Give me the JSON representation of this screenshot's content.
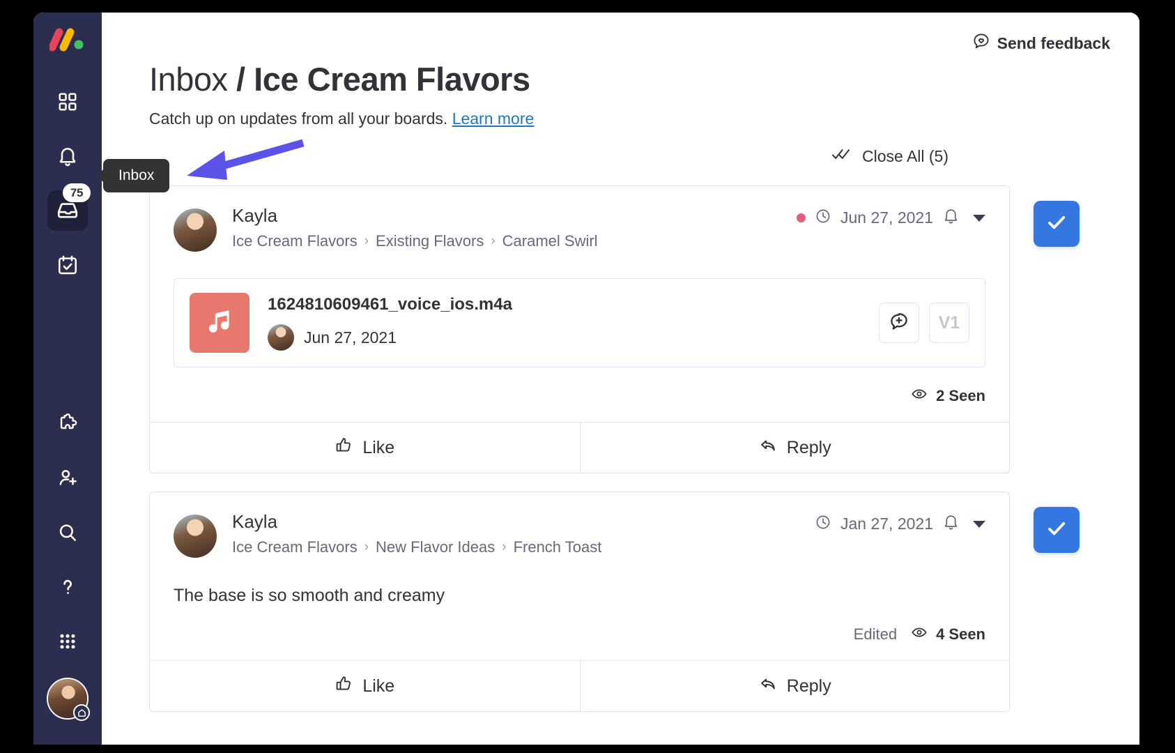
{
  "sidebar": {
    "logo_name": "monday-logo",
    "items": [
      {
        "name": "home-grid",
        "icon": "grid-icon",
        "label": "Home"
      },
      {
        "name": "notifications",
        "icon": "bell-icon",
        "label": "Notifications"
      },
      {
        "name": "inbox",
        "icon": "inbox-icon",
        "label": "Inbox",
        "badge": "75",
        "active": true
      },
      {
        "name": "my-work",
        "icon": "calendar-check-icon",
        "label": "My Work"
      },
      {
        "name": "apps",
        "icon": "puzzle-icon",
        "label": "Apps"
      },
      {
        "name": "invite",
        "icon": "person-add-icon",
        "label": "Invite members"
      },
      {
        "name": "search",
        "icon": "search-icon",
        "label": "Search"
      },
      {
        "name": "help",
        "icon": "question-mark-icon",
        "label": "Help"
      },
      {
        "name": "more",
        "icon": "dots-grid-icon",
        "label": "More"
      }
    ],
    "avatar_label": "Kayla",
    "tooltip": "Inbox"
  },
  "header": {
    "feedback_label": "Send feedback",
    "feedback_icon": "speech-bubble-heart-icon",
    "title_prefix": "Inbox ",
    "title_separator": "/ ",
    "title_main": "Ice Cream Flavors",
    "subtitle": "Catch up on updates from all your boards.",
    "learn_more": "Learn more",
    "close_all": "Close All (5)",
    "close_all_icon": "double-check-icon"
  },
  "feed": {
    "items": [
      {
        "user": "Kayla",
        "breadcrumb": [
          "Ice Cream Flavors",
          "Existing Flavors",
          "Caramel Swirl"
        ],
        "unread": true,
        "date": "Jun 27, 2021",
        "clock_icon": "clock-icon",
        "bell_icon": "bell-icon",
        "caret_icon": "chevron-down-icon",
        "attachment": {
          "file_name": "1624810609461_voice_ios.m4a",
          "file_date": "Jun 27, 2021",
          "file_icon": "music-note-icon",
          "comment_button_icon": "add-comment-icon",
          "version_label": "V1"
        },
        "edited": "",
        "seen": "2 Seen",
        "seen_icon": "eye-icon",
        "like_label": "Like",
        "like_icon": "thumbs-up-icon",
        "reply_label": "Reply",
        "reply_icon": "reply-arrow-icon",
        "close_icon": "check-icon"
      },
      {
        "user": "Kayla",
        "breadcrumb": [
          "Ice Cream Flavors",
          "New Flavor Ideas",
          "French Toast"
        ],
        "unread": false,
        "date": "Jan 27, 2021",
        "clock_icon": "clock-icon",
        "bell_icon": "bell-icon",
        "caret_icon": "chevron-down-icon",
        "message": "The base is so smooth and creamy",
        "edited": "Edited",
        "seen": "4 Seen",
        "seen_icon": "eye-icon",
        "like_label": "Like",
        "like_icon": "thumbs-up-icon",
        "reply_label": "Reply",
        "reply_icon": "reply-arrow-icon",
        "close_icon": "check-icon"
      }
    ]
  },
  "colors": {
    "rail_bg": "#2b2e4f",
    "accent_blue": "#3577e0",
    "link_blue": "#1f76c2",
    "unread_dot": "#e2607a",
    "file_tile": "#e8786e",
    "annotation_arrow": "#5b52e8",
    "tooltip_bg": "#333333"
  }
}
